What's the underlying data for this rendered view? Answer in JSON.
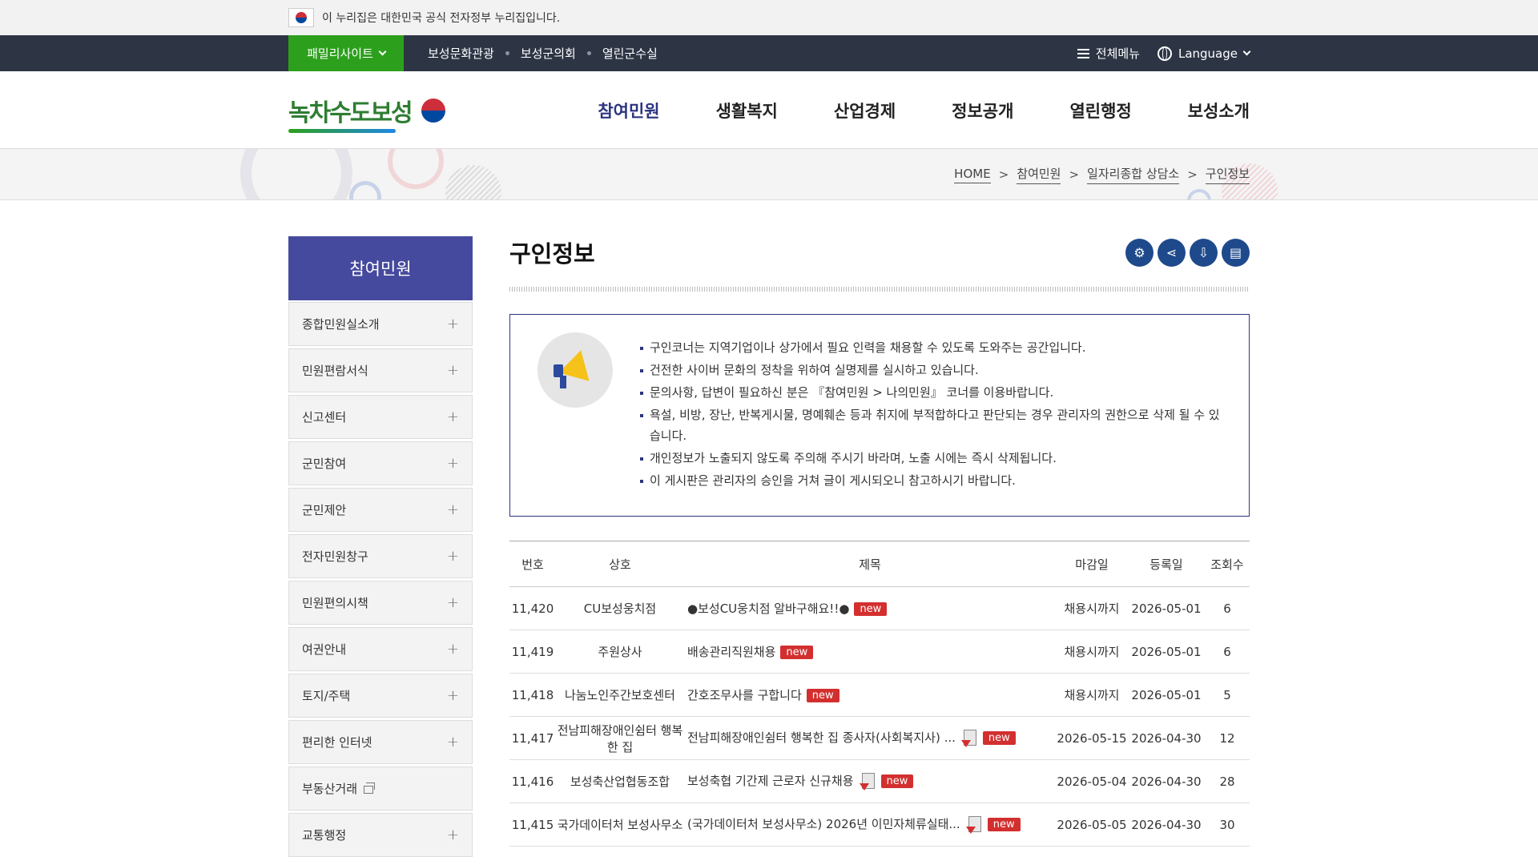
{
  "gov_banner": {
    "text": "이 누리집은 대한민국 공식 전자정부 누리집입니다."
  },
  "topbar": {
    "family_site": "패밀리사이트",
    "links": [
      "보성문화관광",
      "보성군의회",
      "열린군수실"
    ],
    "all_menu": "전체메뉴",
    "language": "Language"
  },
  "header": {
    "logo": "녹차수도보성",
    "gnb": [
      "참여민원",
      "생활복지",
      "산업경제",
      "정보공개",
      "열린행정",
      "보성소개"
    ]
  },
  "breadcrumb": [
    "HOME",
    "참여민원",
    "일자리종합 상담소",
    "구인정보"
  ],
  "colors": {
    "accent": "#2c3580",
    "lnb_title": "#464a9e",
    "family_green": "#2ca01c",
    "topbar": "#2d3545",
    "new_badge": "#d32f2f",
    "tool_blue": "#1e4a8c"
  },
  "lnb": {
    "title": "참여민원",
    "items": [
      {
        "label": "종합민원실소개",
        "icon": "plus-icon"
      },
      {
        "label": "민원편람서식",
        "icon": "plus-icon"
      },
      {
        "label": "신고센터",
        "icon": "plus-icon"
      },
      {
        "label": "군민참여",
        "icon": "plus-icon"
      },
      {
        "label": "군민제안",
        "icon": "plus-icon"
      },
      {
        "label": "전자민원창구",
        "icon": "plus-icon"
      },
      {
        "label": "민원편의시책",
        "icon": "plus-icon"
      },
      {
        "label": "여권안내",
        "icon": "plus-icon"
      },
      {
        "label": "토지/주택",
        "icon": "plus-icon"
      },
      {
        "label": "편리한 인터넷",
        "icon": "plus-icon"
      },
      {
        "label": "부동산거래",
        "icon": "new-window-icon"
      },
      {
        "label": "교통행정",
        "icon": "plus-icon"
      }
    ]
  },
  "main": {
    "title": "구인정보",
    "tools": [
      "settings-icon",
      "share-icon",
      "download-icon",
      "print-icon"
    ],
    "notice": [
      "구인코너는 지역기업이나 상가에서 필요 인력을 채용할 수 있도록 도와주는 공간입니다.",
      "건전한 사이버 문화의 정착을 위하여 실명제를 실시하고 있습니다.",
      "문의사항, 답변이 필요하신 분은 『참여민원 > 나의민원』 코너를 이용바랍니다.",
      "욕설, 비방, 장난, 반복게시물, 명예훼손 등과 취지에 부적합하다고 판단되는 경우 관리자의 권한으로 삭제 될 수 있습니다.",
      "개인정보가 노출되지 않도록 주의해 주시기 바라며, 노출 시에는 즉시 삭제됩니다.",
      "이 게시판은 관리자의 승인을 거쳐 글이 게시되오니 참고하시기 바랍니다."
    ],
    "table": {
      "headers": [
        "번호",
        "상호",
        "제목",
        "마감일",
        "등록일",
        "조회수"
      ],
      "new_label": "new",
      "rows": [
        {
          "no": "11,420",
          "company": "CU보성웅치점",
          "subject": "●보성CU웅치점 알바구해요!!●",
          "attach": false,
          "deadline": "채용시까지",
          "date": "2026-05-01",
          "views": "6"
        },
        {
          "no": "11,419",
          "company": "주원상사",
          "subject": "배송관리직원채용",
          "attach": false,
          "deadline": "채용시까지",
          "date": "2026-05-01",
          "views": "6"
        },
        {
          "no": "11,418",
          "company": "나눔노인주간보호센터",
          "subject": "간호조무사를 구합니다",
          "attach": false,
          "deadline": "채용시까지",
          "date": "2026-05-01",
          "views": "5"
        },
        {
          "no": "11,417",
          "company": "전남피해장애인쉼터 행복한 집",
          "subject": "전남피해장애인쉼터 행복한 집 종사자(사회복지사) ...",
          "attach": true,
          "deadline": "2026-05-15",
          "date": "2026-04-30",
          "views": "12"
        },
        {
          "no": "11,416",
          "company": "보성축산업협동조합",
          "subject": "보성축협 기간제 근로자 신규채용",
          "attach": true,
          "deadline": "2026-05-04",
          "date": "2026-04-30",
          "views": "28"
        },
        {
          "no": "11,415",
          "company": "국가데이터처 보성사무소",
          "subject": "(국가데이터처 보성사무소) 2026년 이민자체류실태...",
          "attach": true,
          "deadline": "2026-05-05",
          "date": "2026-04-30",
          "views": "30"
        }
      ]
    }
  }
}
